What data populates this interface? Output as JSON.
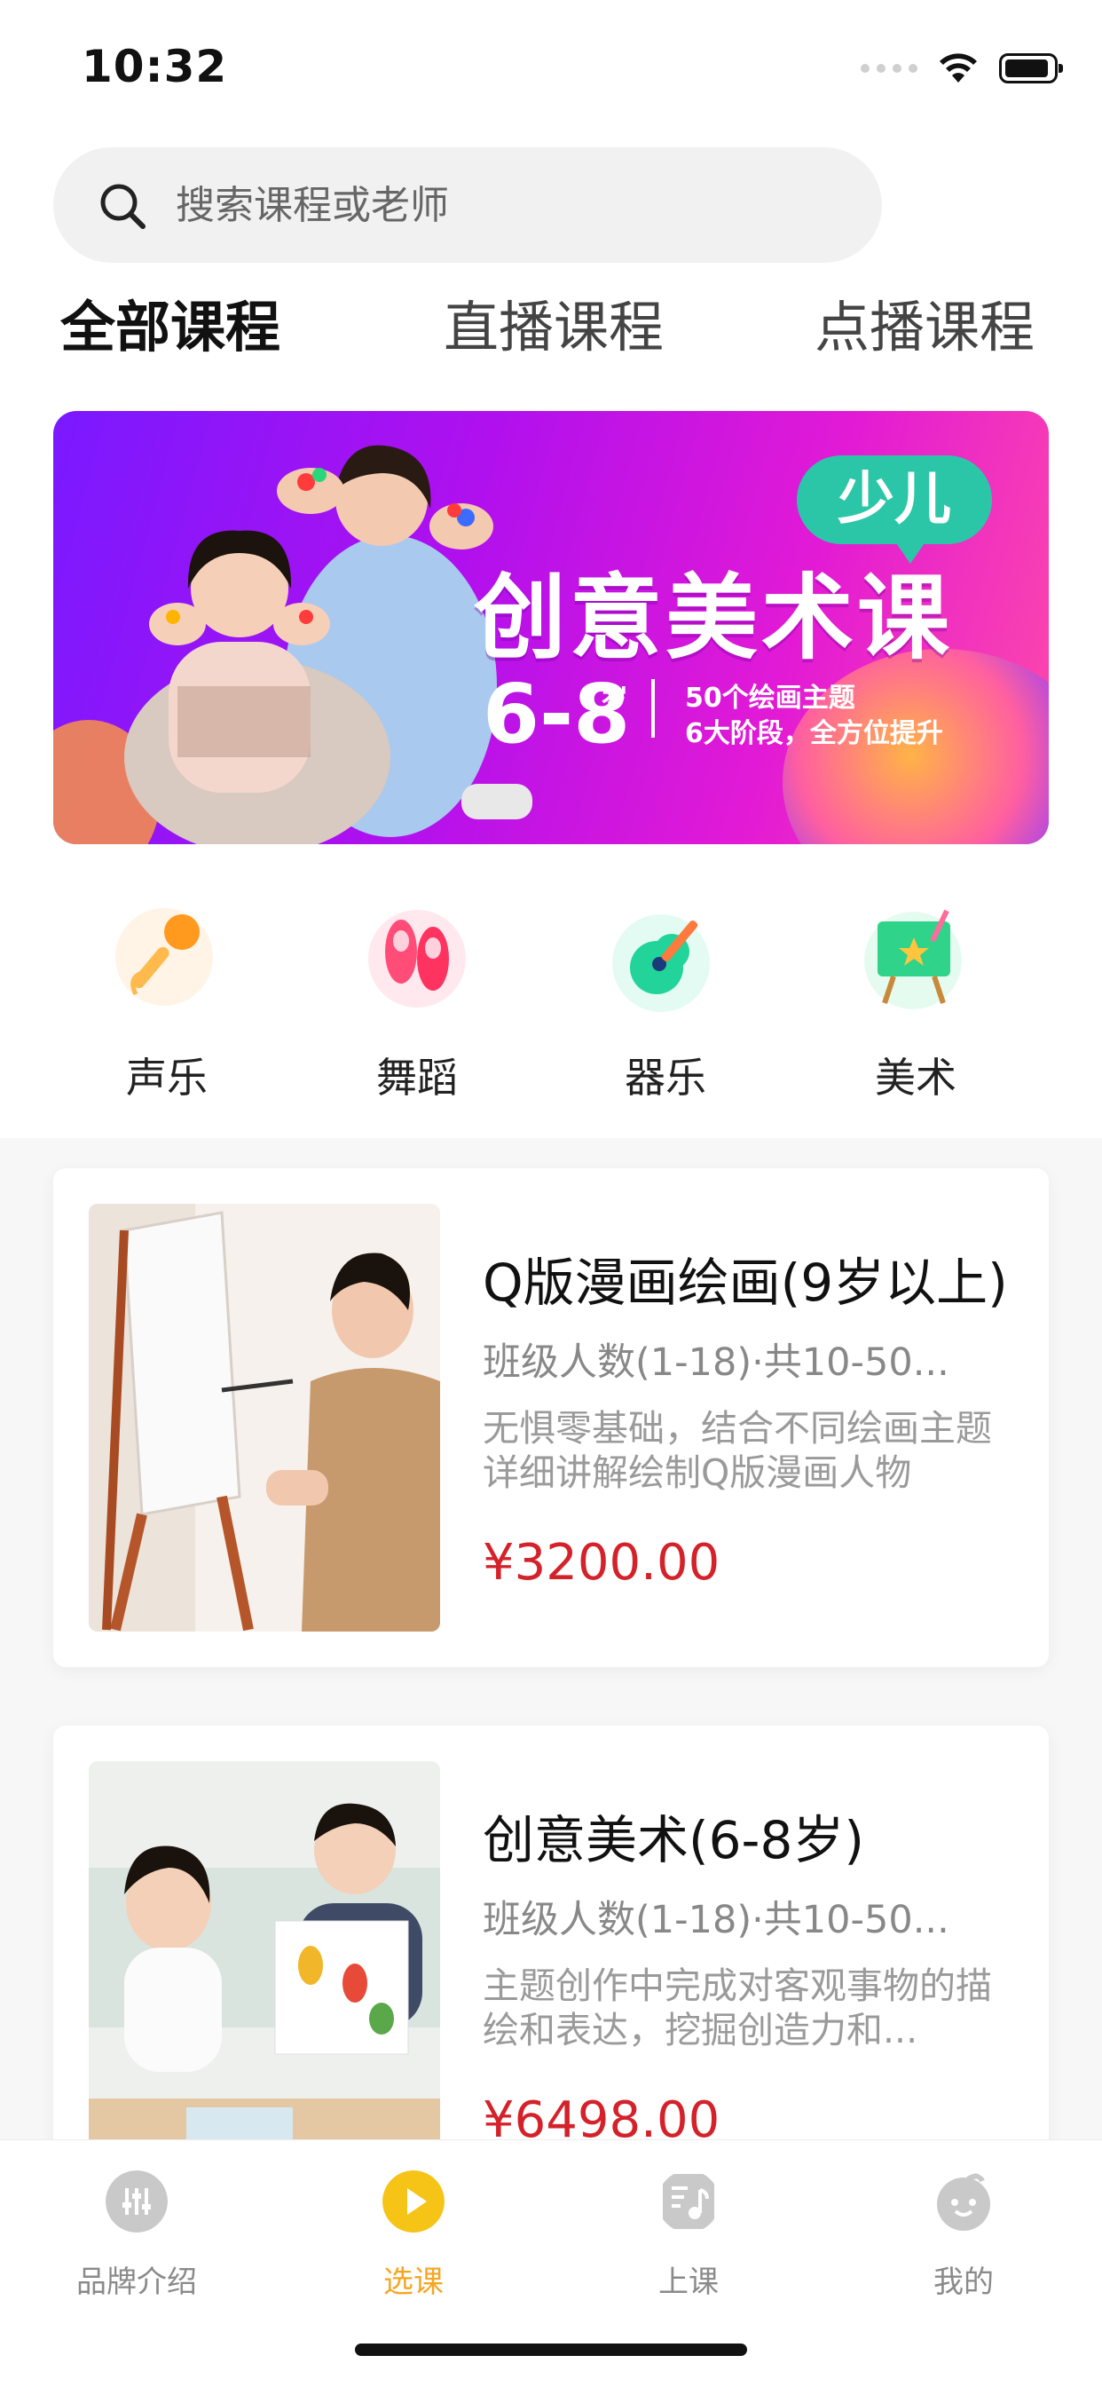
{
  "status_bar": {
    "time": "10:32"
  },
  "search": {
    "placeholder": "搜索课程或老师"
  },
  "tabs": [
    {
      "label": "全部课程",
      "active": true
    },
    {
      "label": "直播课程",
      "active": false
    },
    {
      "label": "点播课程",
      "active": false
    }
  ],
  "banner": {
    "badge": "少儿",
    "title": "创意美术课",
    "age": "6-8",
    "age_unit": "岁",
    "line1": "50个绘画主题",
    "line2": "6大阶段，全方位提升"
  },
  "categories": [
    {
      "label": "声乐",
      "icon": "microphone-icon"
    },
    {
      "label": "舞蹈",
      "icon": "ballet-shoes-icon"
    },
    {
      "label": "器乐",
      "icon": "guitar-icon"
    },
    {
      "label": "美术",
      "icon": "easel-icon"
    }
  ],
  "courses": [
    {
      "title": "Q版漫画绘画(9岁以上)",
      "meta": "班级人数(1-18)·共10-50...",
      "desc": "无惧零基础，结合不同绘画主题详细讲解绘制Q版漫画人物",
      "price": "¥3200.00"
    },
    {
      "title": "创意美术(6-8岁)",
      "meta": "班级人数(1-18)·共10-50...",
      "desc": "主题创作中完成对客观事物的描绘和表达，挖掘创造力和...",
      "price": "¥6498.00"
    }
  ],
  "tabbar": [
    {
      "label": "品牌介绍",
      "icon": "sliders-icon",
      "active": false
    },
    {
      "label": "选课",
      "icon": "play-icon",
      "active": true
    },
    {
      "label": "上课",
      "icon": "music-note-icon",
      "active": false
    },
    {
      "label": "我的",
      "icon": "profile-face-icon",
      "active": false
    }
  ],
  "colors": {
    "accent": "#f5a623",
    "price": "#d4222a",
    "tab_highlight": "#f7d36b",
    "badge": "#2bc6a8"
  }
}
